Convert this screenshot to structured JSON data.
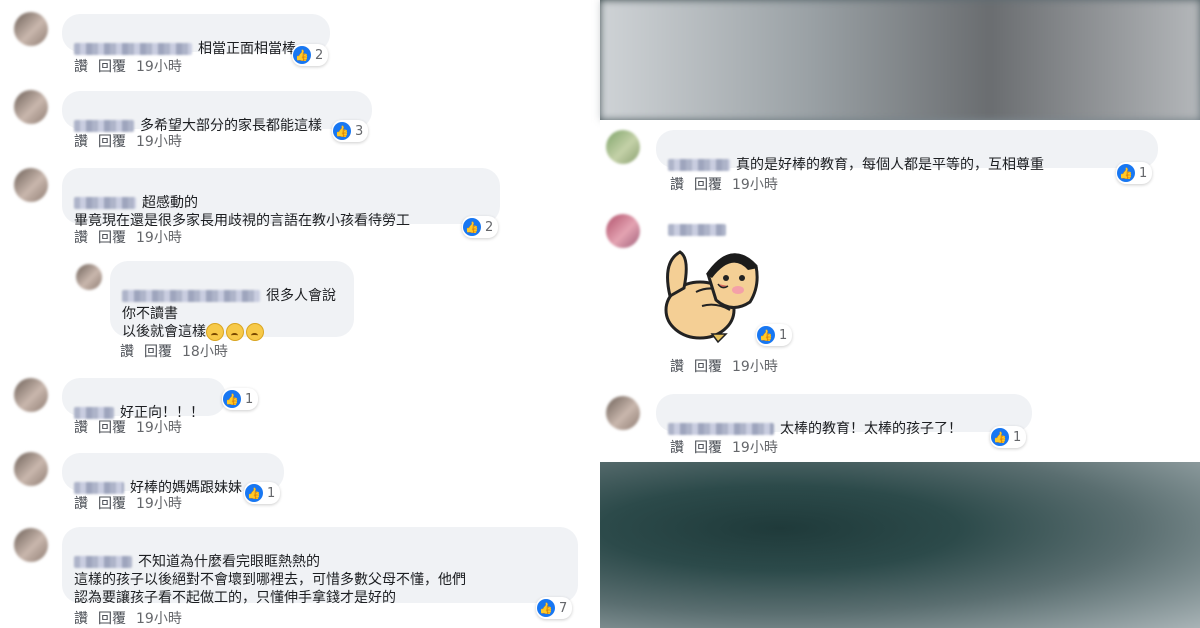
{
  "actions": {
    "like": "讚",
    "reply": "回覆"
  },
  "left_comments": [
    {
      "text": "相當正面相當棒~",
      "time": "19小時",
      "reactions": "2"
    },
    {
      "text": "多希望大部分的家長都能這樣",
      "time": "19小時",
      "reactions": "3"
    },
    {
      "text": "超感動的\n畢竟現在還是很多家長用歧視的言語在教小孩看待勞工",
      "time": "19小時",
      "reactions": "2"
    },
    {
      "text": "很多人會說\n你不讀書\n以後就會這樣",
      "time": "18小時",
      "emoji": "sad-face-emoji"
    },
    {
      "text": "好正向！！！",
      "time": "19小時",
      "reactions": "1"
    },
    {
      "text": "好棒的媽媽跟妹妹",
      "time": "19小時",
      "reactions": "1"
    },
    {
      "text": "不知道為什麼看完眼眶熱熱的\n這樣的孩子以後絕對不會壞到哪裡去，可惜多數父母不懂，他們\n認為要讓孩子看不起做工的，只懂伸手拿錢才是好的",
      "time": "19小時",
      "reactions": "7"
    }
  ],
  "right_comments": [
    {
      "text": "真的是好棒的教育，每個人都是平等的，互相尊重",
      "time": "19小時",
      "reactions": "1"
    },
    {
      "text": "",
      "time": "19小時",
      "reactions": "1",
      "sticker": "thumbs-up-girl-sticker"
    },
    {
      "text": "太棒的教育！太棒的孩子了！",
      "time": "19小時",
      "reactions": "1"
    }
  ],
  "colors": {
    "bubble": "#f0f2f5",
    "like": "#1877f2",
    "text": "#1c1e21",
    "meta": "#65676b"
  },
  "icons": {
    "like": "like-icon",
    "emoji": "sad-face-emoji"
  }
}
